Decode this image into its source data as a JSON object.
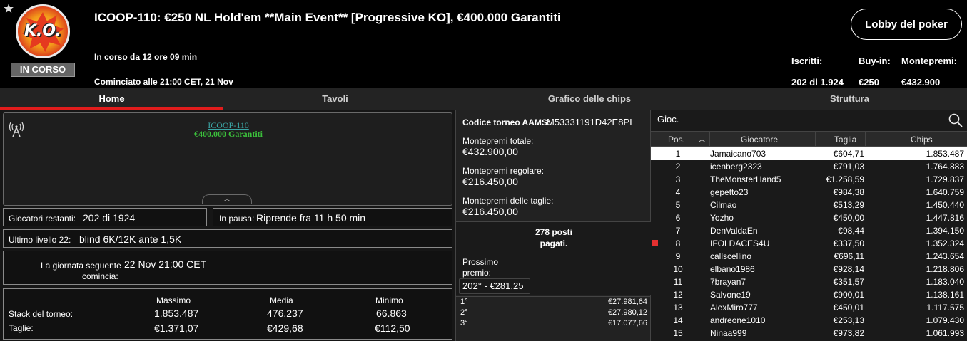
{
  "header": {
    "logo_text": "K.O.",
    "status": "IN CORSO",
    "title": "ICOOP-110: €250 NL Hold'em **Main Event** [Progressive KO], €400.000 Garantiti",
    "running": "In corso da 12 ore 09 min",
    "started": "Cominciato alle 21:00 CET, 21 Nov",
    "lobby_button": "Lobby del poker",
    "stats": {
      "entries_label": "Iscritti:",
      "entries_value": "202 di 1.924",
      "buyin_label": "Buy-in:",
      "buyin_value": "€250",
      "prize_label": "Montepremi:",
      "prize_value": "€432.900"
    }
  },
  "tabs": [
    "Home",
    "Tavoli",
    "Grafico delle chips",
    "Struttura"
  ],
  "left": {
    "widget_name": "ICOOP-110",
    "widget_prize": "€400.000 Garantiti",
    "players_left_label": "Giocatori restanti:",
    "players_left_value": "202 di 1924",
    "paused_label": "In pausa:",
    "paused_value": "Riprende fra 11 h 50 min",
    "level_label": "Ultimo livello 22:",
    "level_value": "blind 6K/12K ante 1,5K",
    "next_day_label_1": "La giornata seguente",
    "next_day_label_2": "comincia:",
    "next_day_value": "22 Nov 21:00 CET",
    "stack": {
      "col_max": "Massimo",
      "col_avg": "Media",
      "col_min": "Minimo",
      "row_stack": "Stack del torneo:",
      "row_bounty": "Taglie:",
      "stack_max": "1.853.487",
      "stack_avg": "476.237",
      "stack_min": "66.863",
      "bounty_max": "€1.371,07",
      "bounty_avg": "€429,68",
      "bounty_min": "€112,50"
    }
  },
  "middle": {
    "aams_label": "Codice torneo AAMS:",
    "aams_code": "M53331191D42E8PI",
    "total_prize_label": "Montepremi totale:",
    "total_prize_value": "€432.900,00",
    "regular_prize_label": "Montepremi regolare:",
    "regular_prize_value": "€216.450,00",
    "bounty_prize_label": "Montepremi delle taglie:",
    "bounty_prize_value": "€216.450,00",
    "paid_line_1": "278 posti",
    "paid_line_2": "pagati.",
    "next_prize_label_1": "Prossimo",
    "next_prize_label_2": "premio:",
    "next_prize_value": "202° - €281,25",
    "prizes": [
      {
        "pos": "1°",
        "amount": "€27.981,64"
      },
      {
        "pos": "2°",
        "amount": "€27.980,12"
      },
      {
        "pos": "3°",
        "amount": "€17.077,66"
      }
    ]
  },
  "right": {
    "title": "Gioc.",
    "columns": {
      "pos": "Pos.",
      "player": "Giocatore",
      "bounty": "Taglia",
      "chips": "Chips"
    },
    "players": [
      {
        "pos": "1",
        "name": "Jamaicano703",
        "bounty": "€604,71",
        "chips": "1.853.487"
      },
      {
        "pos": "2",
        "name": "icenberg2323",
        "bounty": "€791,03",
        "chips": "1.764.883"
      },
      {
        "pos": "3",
        "name": "TheMonsterHand5",
        "bounty": "€1.258,59",
        "chips": "1.729.837"
      },
      {
        "pos": "4",
        "name": "gepetto23",
        "bounty": "€984,38",
        "chips": "1.640.759"
      },
      {
        "pos": "5",
        "name": "Cilmao",
        "bounty": "€513,29",
        "chips": "1.450.440"
      },
      {
        "pos": "6",
        "name": "Yozho",
        "bounty": "€450,00",
        "chips": "1.447.816"
      },
      {
        "pos": "7",
        "name": "DenValdaEn",
        "bounty": "€98,44",
        "chips": "1.394.150"
      },
      {
        "pos": "8",
        "name": "IFOLDACES4U",
        "bounty": "€337,50",
        "chips": "1.352.324"
      },
      {
        "pos": "9",
        "name": "callscellino",
        "bounty": "€696,11",
        "chips": "1.243.654"
      },
      {
        "pos": "10",
        "name": "elbano1986",
        "bounty": "€928,14",
        "chips": "1.218.806"
      },
      {
        "pos": "11",
        "name": "7brayan7",
        "bounty": "€351,57",
        "chips": "1.183.040"
      },
      {
        "pos": "12",
        "name": "Salvone19",
        "bounty": "€900,01",
        "chips": "1.138.161"
      },
      {
        "pos": "13",
        "name": "AlexMiro777",
        "bounty": "€450,01",
        "chips": "1.117.575"
      },
      {
        "pos": "14",
        "name": "andreone1010",
        "bounty": "€253,13",
        "chips": "1.079.430"
      },
      {
        "pos": "15",
        "name": "Ninaa999",
        "bounty": "€973,82",
        "chips": "1.061.993"
      }
    ]
  },
  "colors": {
    "accent_red": "#e21c1c",
    "link_teal": "#3ba5a5",
    "prize_green": "#3bbf3b"
  }
}
